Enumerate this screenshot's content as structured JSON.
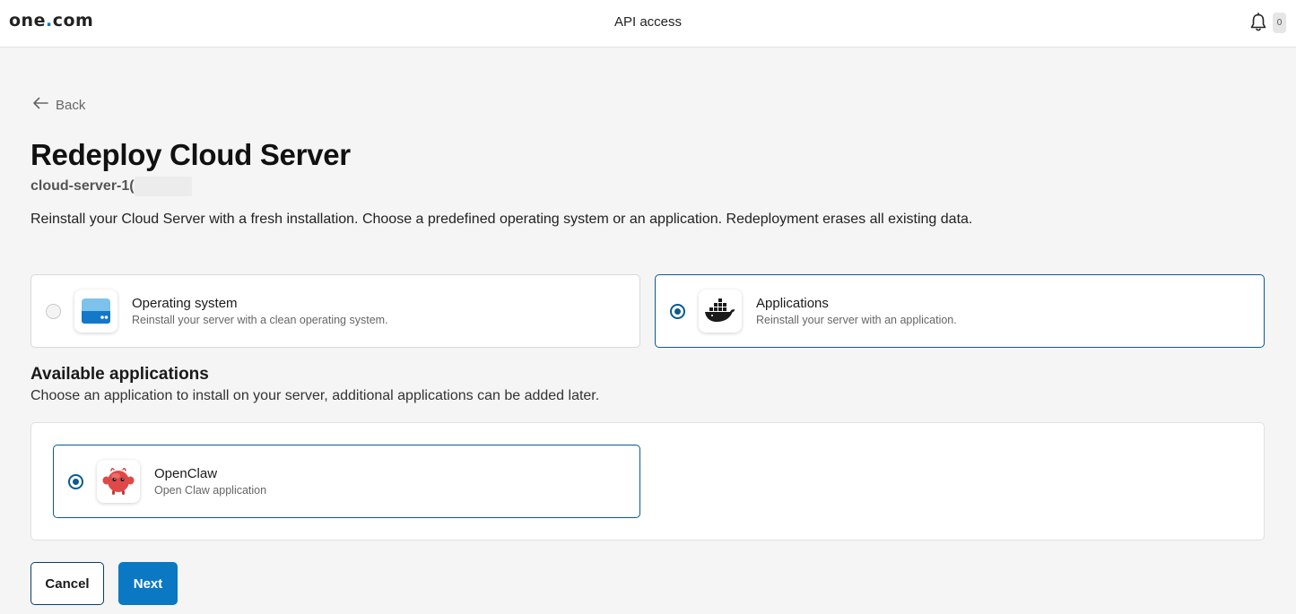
{
  "header": {
    "logo_text_left": "one",
    "logo_dot": ".",
    "logo_text_right": "com",
    "title": "API access",
    "notification_count": "0"
  },
  "nav": {
    "back_label": "Back"
  },
  "page": {
    "title": "Redeploy Cloud Server",
    "server_name": "cloud-server-1(",
    "intro": "Reinstall your Cloud Server with a fresh installation. Choose a predefined operating system or an application. Redeployment erases all existing data."
  },
  "install_types": [
    {
      "title": "Operating system",
      "description": "Reinstall your server with a clean operating system.",
      "selected": false,
      "icon": "server-icon"
    },
    {
      "title": "Applications",
      "description": "Reinstall your server with an application.",
      "selected": true,
      "icon": "docker-whale-icon"
    }
  ],
  "applications_section": {
    "title": "Available applications",
    "subtitle": "Choose an application to install on your server, additional applications can be added later.",
    "apps": [
      {
        "title": "OpenClaw",
        "description": "Open Claw application",
        "selected": true,
        "icon": "openclaw-crab-icon"
      }
    ]
  },
  "actions": {
    "cancel_label": "Cancel",
    "next_label": "Next"
  },
  "colors": {
    "accent": "#0a78c2",
    "selected_border": "#0b5a8f",
    "background": "#f5f5f5"
  }
}
